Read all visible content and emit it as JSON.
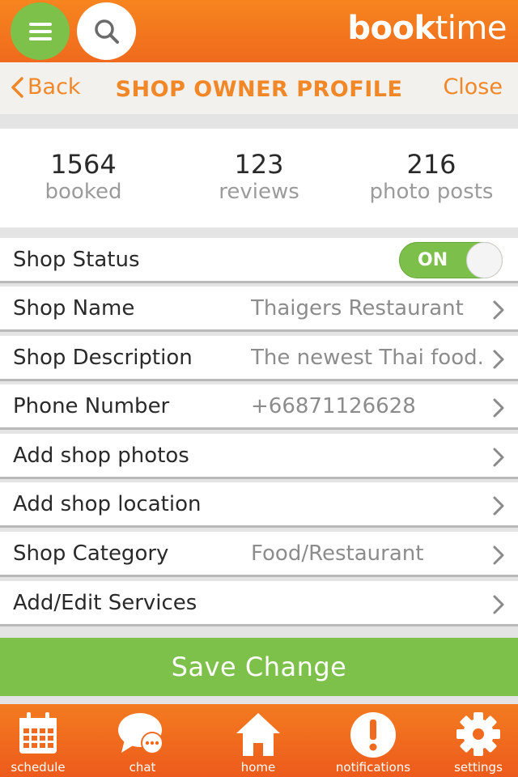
{
  "header": {
    "logo_bold": "book",
    "logo_light": "time",
    "menu_icon": "hamburger-icon",
    "search_icon": "search-icon"
  },
  "nav": {
    "back_label": "Back",
    "title": "SHOP OWNER PROFILE",
    "close_label": "Close"
  },
  "stats": [
    {
      "value": "1564",
      "label": "booked"
    },
    {
      "value": "123",
      "label": "reviews"
    },
    {
      "value": "216",
      "label": "photo posts"
    }
  ],
  "settings": {
    "shop_status": {
      "label": "Shop Status",
      "toggle": "ON"
    },
    "rows": [
      {
        "label": "Shop Name",
        "value": "Thaigers Restaurant"
      },
      {
        "label": "Shop Description",
        "value": "The newest Thai food.."
      },
      {
        "label": "Phone Number",
        "value": "+66871126628"
      },
      {
        "label": "Add shop photos",
        "value": ""
      },
      {
        "label": "Add shop location",
        "value": ""
      },
      {
        "label": "Shop Category",
        "value": "Food/Restaurant"
      },
      {
        "label": "Add/Edit Services",
        "value": ""
      }
    ]
  },
  "save_button": "Save Change",
  "tabbar": [
    {
      "label": "schedule",
      "icon": "calendar-icon"
    },
    {
      "label": "chat",
      "icon": "chat-bubble-icon"
    },
    {
      "label": "home",
      "icon": "home-icon"
    },
    {
      "label": "notifications",
      "icon": "exclamation-icon"
    },
    {
      "label": "settings",
      "icon": "gear-icon"
    }
  ],
  "colors": {
    "brand_orange": "#f18727",
    "accent_green": "#7dc04a"
  }
}
